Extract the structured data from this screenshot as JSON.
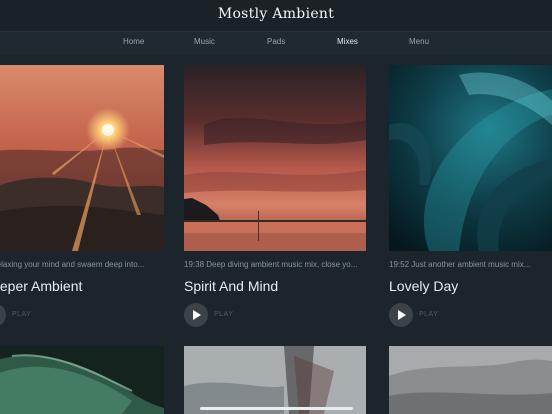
{
  "app": {
    "title": "Mostly Ambient"
  },
  "nav": {
    "items": [
      {
        "label": "Home"
      },
      {
        "label": "Music"
      },
      {
        "label": "Pads"
      },
      {
        "label": "Mixes"
      },
      {
        "label": "Menu"
      }
    ]
  },
  "cards": [
    {
      "desc": "... Relaxing your mind and swaem deep into...",
      "title": "Deeper Ambient",
      "play": "PLAY",
      "image": "sunset-over-hills"
    },
    {
      "desc": "19:38 Deep diving ambient music mix, close yo...",
      "title": "Spirit And Mind",
      "play": "PLAY",
      "image": "sunset-over-sea"
    },
    {
      "desc": "19:52 Just another ambient music mix...",
      "title": "Lovely Day",
      "play": "PLAY",
      "image": "teal-abstract-swirl"
    }
  ],
  "bottom_row": [
    {
      "image": "green-wave"
    },
    {
      "image": "misty-forest"
    },
    {
      "image": "grey-clouds"
    }
  ],
  "colors": {
    "background": "#1c252c",
    "topbar": "#1a2228",
    "nav": "#1f2930",
    "play_button": "#3b4349"
  }
}
